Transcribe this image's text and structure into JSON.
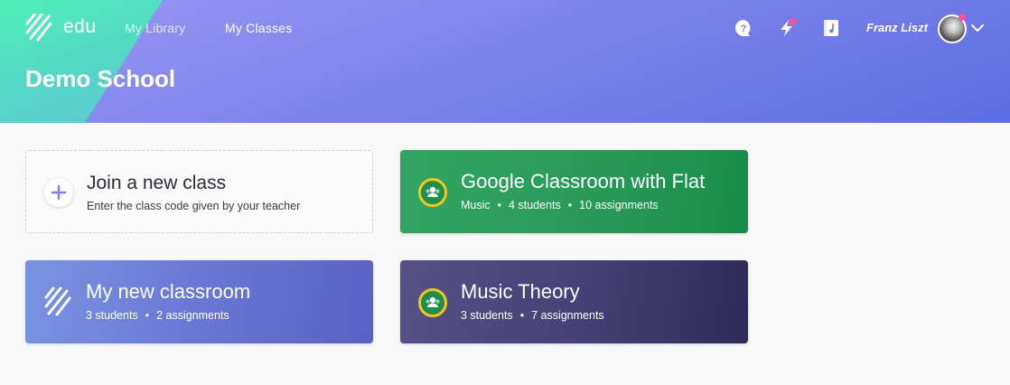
{
  "header": {
    "logo_text": "edu",
    "nav": [
      "My Library",
      "My Classes"
    ],
    "school_name": "Demo School",
    "icons": [
      "help-icon",
      "lightning-icon",
      "music-book-icon"
    ],
    "user_name": "Franz Liszt",
    "colors": {
      "header_start": "#9a98f4",
      "header_end": "#5d6fe3",
      "accent_teal": "#4ff0b8",
      "notification_dot": "#ff4fa0"
    }
  },
  "join_card": {
    "title": "Join a new class",
    "subtitle": "Enter the class code given by your teacher"
  },
  "classes": [
    {
      "title": "Google Classroom with Flat",
      "meta": [
        "Music",
        "4 students",
        "10 assignments"
      ],
      "icon": "google-classroom-icon",
      "color": "#2a9a5a"
    },
    {
      "title": "My new classroom",
      "meta": [
        "3 students",
        "2 assignments"
      ],
      "icon": "flat-logo-icon",
      "color": "#6977d4"
    },
    {
      "title": "Music Theory",
      "meta": [
        "3 students",
        "7 assignments"
      ],
      "icon": "google-classroom-icon",
      "color": "#443f74"
    }
  ]
}
